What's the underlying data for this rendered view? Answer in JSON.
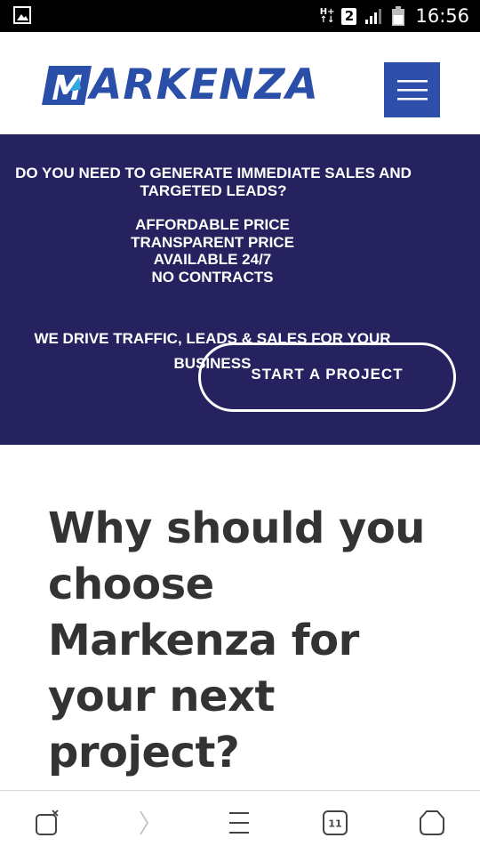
{
  "status_bar": {
    "time": "16:56",
    "network_top": "H+",
    "network_bottom": "↑↓",
    "sim_slot": "2",
    "icons": [
      "image-notification-icon",
      "signal-icon",
      "battery-icon"
    ]
  },
  "header": {
    "logo_text": "ARKENZA",
    "logo_icon": "logo-m-icon",
    "menu_icon": "hamburger-menu-icon",
    "brand_color": "#2d4eab"
  },
  "hero": {
    "heading": "DO YOU NEED TO GENERATE IMMEDIATE SALES AND TARGETED LEADS?",
    "features": [
      "AFFORDABLE  PRICE",
      "TRANSPARENT PRICE",
      "AVAILABLE  24/7",
      "NO CONTRACTS"
    ],
    "tagline": "WE DRIVE TRAFFIC, LEADS & SALES FOR YOUR BUSINESS",
    "cta_label": "START A PROJECT",
    "background_color": "#26215f"
  },
  "why": {
    "title": "Why should you choose Markenza for your next project?"
  },
  "browser_bar": {
    "tab_count": "11",
    "icons": [
      "close-tab-icon",
      "forward-icon",
      "menu-icon",
      "tabs-icon",
      "home-icon"
    ]
  }
}
